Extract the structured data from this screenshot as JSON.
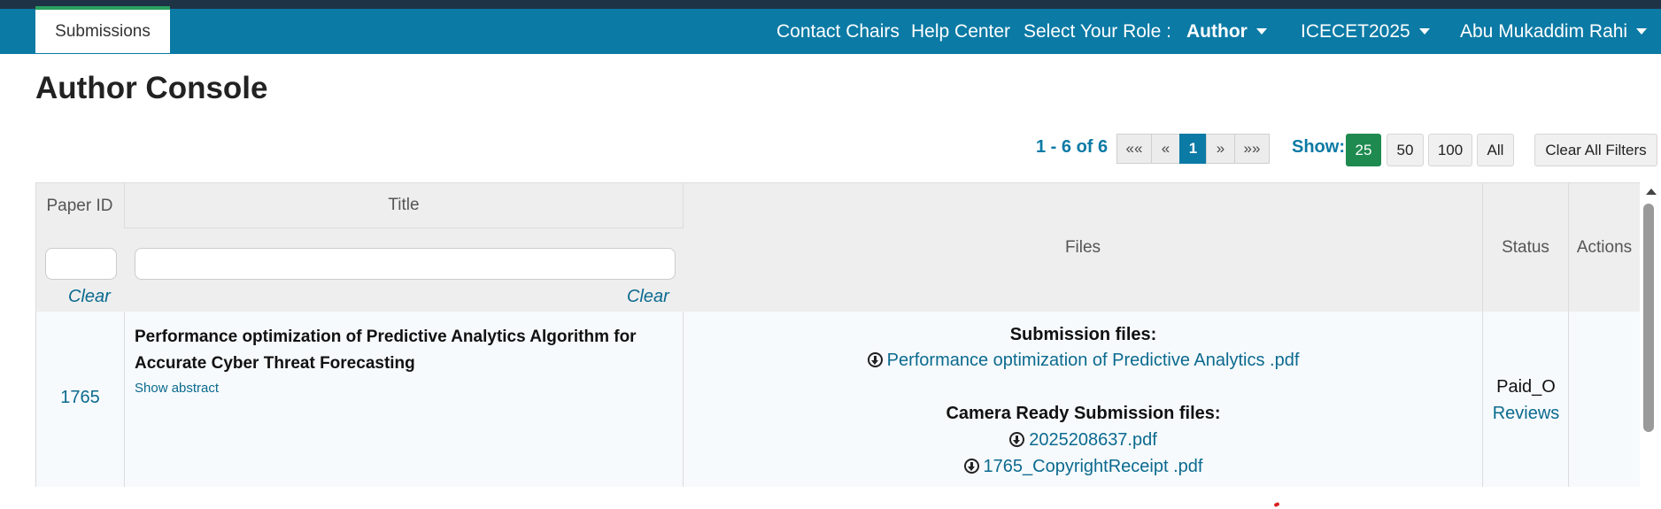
{
  "nav": {
    "tab_label": "Submissions",
    "contact": "Contact Chairs",
    "help": "Help Center",
    "role_label": "Select Your Role :",
    "role_value": "Author",
    "conference": "ICECET2025",
    "user": "Abu Mukaddim Rahi"
  },
  "page": {
    "title": "Author Console"
  },
  "pager": {
    "summary": "1 - 6 of 6",
    "first": "««",
    "prev": "«",
    "current": "1",
    "next": "»",
    "last": "»»",
    "show_label": "Show:",
    "sizes": [
      "25",
      "50",
      "100",
      "All"
    ],
    "selected_size": "25",
    "clear_all": "Clear All Filters"
  },
  "table": {
    "headers": {
      "paper_id": "Paper ID",
      "title": "Title",
      "files": "Files",
      "status": "Status",
      "actions": "Actions"
    },
    "filters": {
      "paper_id_clear": "Clear",
      "title_clear": "Clear",
      "paper_id_value": "",
      "title_value": ""
    },
    "rows": [
      {
        "paper_id": "1765",
        "title": "Performance optimization of Predictive Analytics Algorithm for Accurate Cyber Threat Forecasting",
        "show_abstract": "Show abstract",
        "submission_files_label": "Submission files:",
        "submission_file": "Performance optimization of Predictive Analytics .pdf",
        "camera_ready_label": "Camera Ready Submission files:",
        "camera_files": [
          "2025208637.pdf",
          "1765_CopyrightReceipt .pdf"
        ],
        "status": "Paid_O",
        "reviews_link": "Reviews"
      }
    ]
  },
  "colors": {
    "navbar": "#0b7aa5",
    "accent_green": "#1e8a4f",
    "link": "#0b6a8f"
  },
  "icons": [
    "download-icon",
    "caret-down-icon",
    "scroll-up-icon"
  ]
}
